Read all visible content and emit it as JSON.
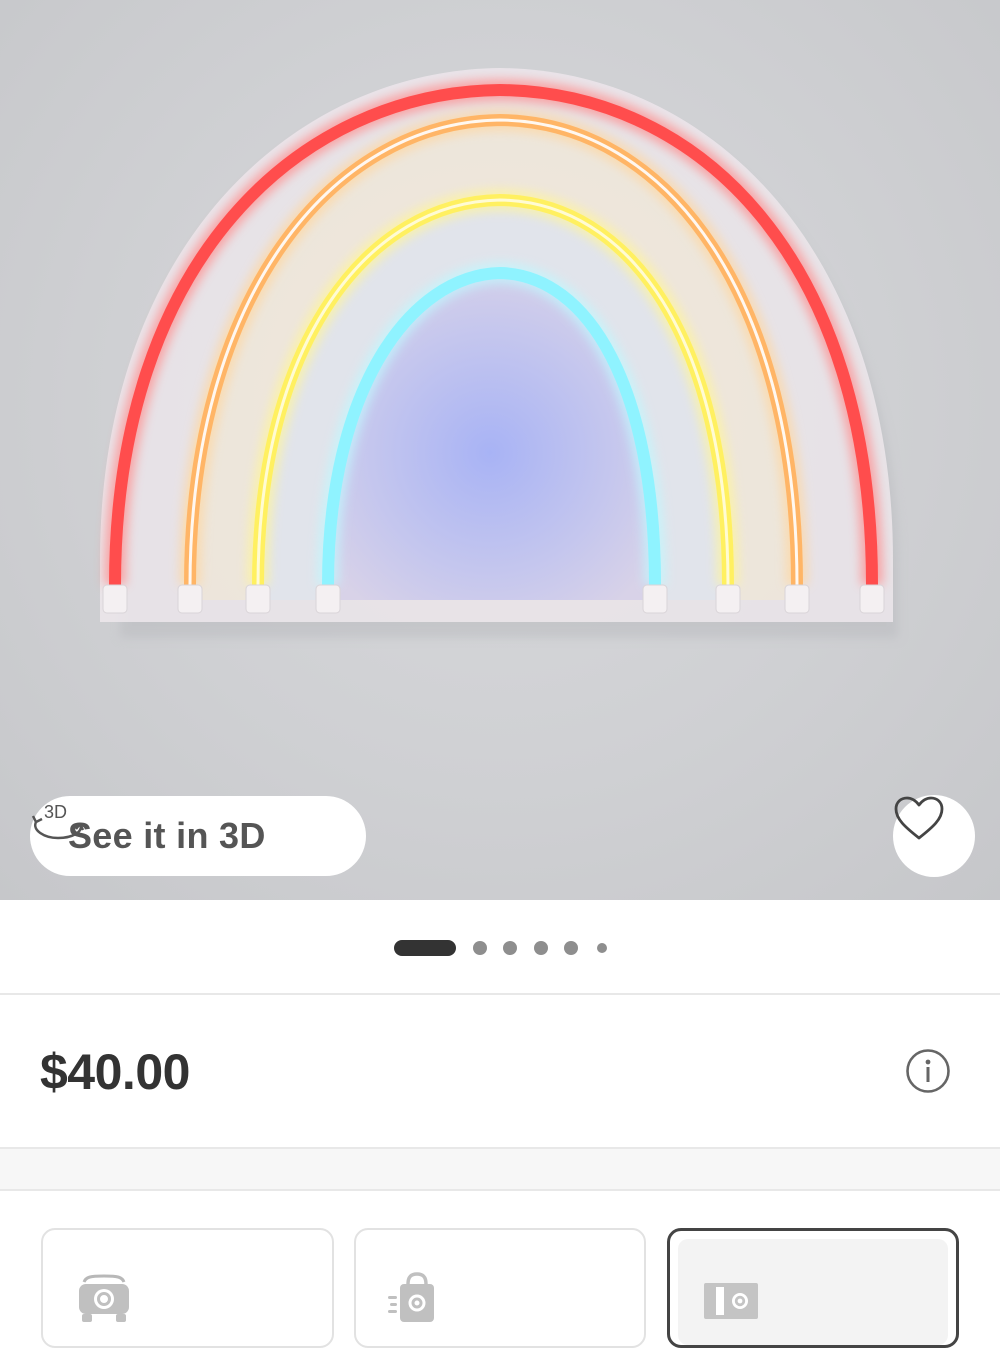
{
  "hero": {
    "see_3d_label": "See it in 3D",
    "three_d_icon": "3d-rotate-icon",
    "favorite_icon": "heart-icon"
  },
  "carousel": {
    "total_dots": 6,
    "active_index": 0
  },
  "pricing": {
    "price": "$40.00",
    "info_icon": "info-icon"
  },
  "fulfillment": {
    "options": [
      {
        "icon": "drive-up-car-icon",
        "selected": false
      },
      {
        "icon": "order-pickup-bag-icon",
        "selected": false
      },
      {
        "icon": "shipping-truck-icon",
        "selected": true
      }
    ]
  },
  "colors": {
    "price_text": "#333333",
    "rainbow_red": "#ff4d4d",
    "rainbow_orange": "#ffb566",
    "rainbow_yellow": "#fff060",
    "rainbow_cyan": "#8ff3ff"
  }
}
